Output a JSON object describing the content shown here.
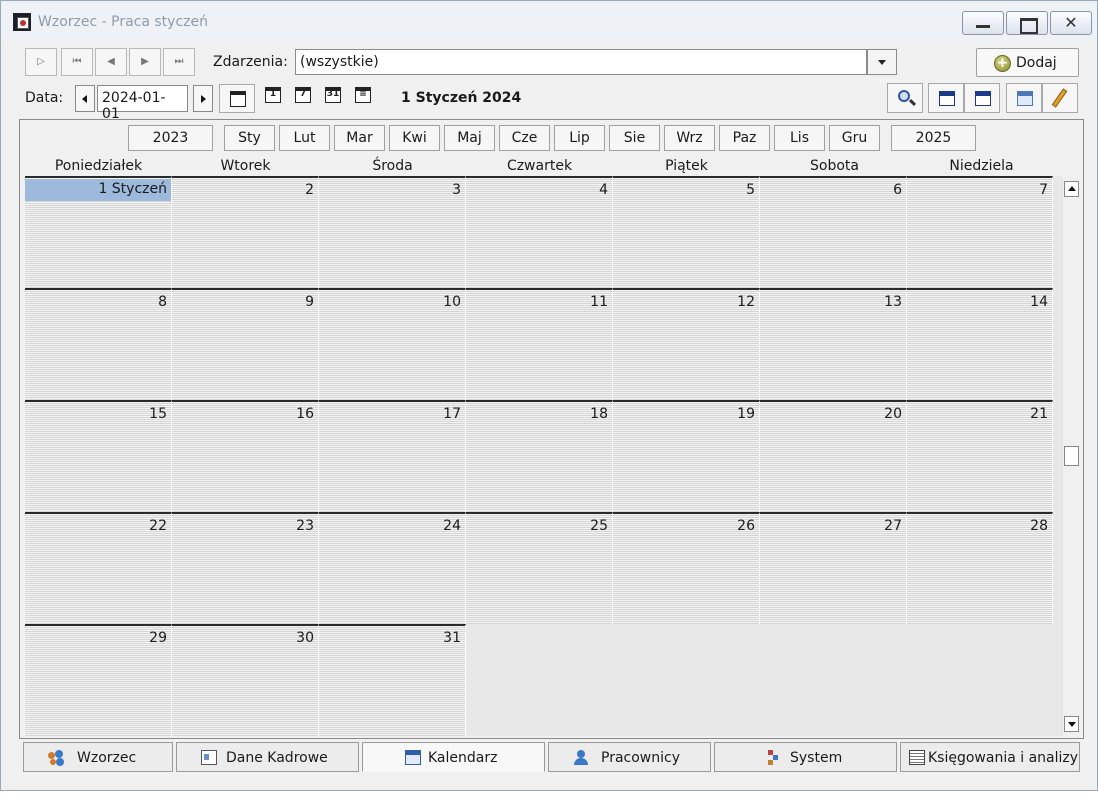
{
  "window": {
    "title": "Wzorzec - Praca styczeń",
    "close_glyph": "✕"
  },
  "nav": {
    "first_glyph": "ᐅ",
    "buttons": [
      "▷",
      "⏮",
      "◀",
      "▶",
      "⏭"
    ]
  },
  "filter": {
    "label": "Zdarzenia:",
    "value": "(wszystkie)"
  },
  "add_button": {
    "label": "Dodaj",
    "icon": "plus-circle-icon"
  },
  "date": {
    "label": "Data:",
    "value": "2024-01-01",
    "view_icons": [
      "1",
      "7",
      "31",
      "≡"
    ],
    "current_display": "1 Styczeń 2024"
  },
  "toolbar_right_icons": [
    "magnifier-icon",
    "calendar-dark-icon",
    "calendar-grid-icon",
    "calendar-blue-icon",
    "pencil-icon"
  ],
  "calendar": {
    "prev_year": "2023",
    "next_year": "2025",
    "months": [
      "Sty",
      "Lut",
      "Mar",
      "Kwi",
      "Maj",
      "Cze",
      "Lip",
      "Sie",
      "Wrz",
      "Paz",
      "Lis",
      "Gru"
    ],
    "weekdays": [
      "Poniedziałek",
      "Wtorek",
      "Środa",
      "Czwartek",
      "Piątek",
      "Sobota",
      "Niedziela"
    ],
    "first_day_label": "1 Styczeń",
    "days": [
      "1 Styczeń",
      "2",
      "3",
      "4",
      "5",
      "6",
      "7",
      "8",
      "9",
      "10",
      "11",
      "12",
      "13",
      "14",
      "15",
      "16",
      "17",
      "18",
      "19",
      "20",
      "21",
      "22",
      "23",
      "24",
      "25",
      "26",
      "27",
      "28",
      "29",
      "30",
      "31"
    ],
    "highlight_color": "#9db9dc"
  },
  "tabs": [
    {
      "label": "Wzorzec",
      "icon": "people-icon",
      "active": false
    },
    {
      "label": "Dane Kadrowe",
      "icon": "id-card-icon",
      "active": false
    },
    {
      "label": "Kalendarz",
      "icon": "calendar-icon",
      "active": true
    },
    {
      "label": "Pracownicy",
      "icon": "user-icon",
      "active": false
    },
    {
      "label": "System",
      "icon": "system-tree-icon",
      "active": false
    },
    {
      "label": "Księgowania i analizy",
      "icon": "ledger-icon",
      "active": false
    }
  ]
}
